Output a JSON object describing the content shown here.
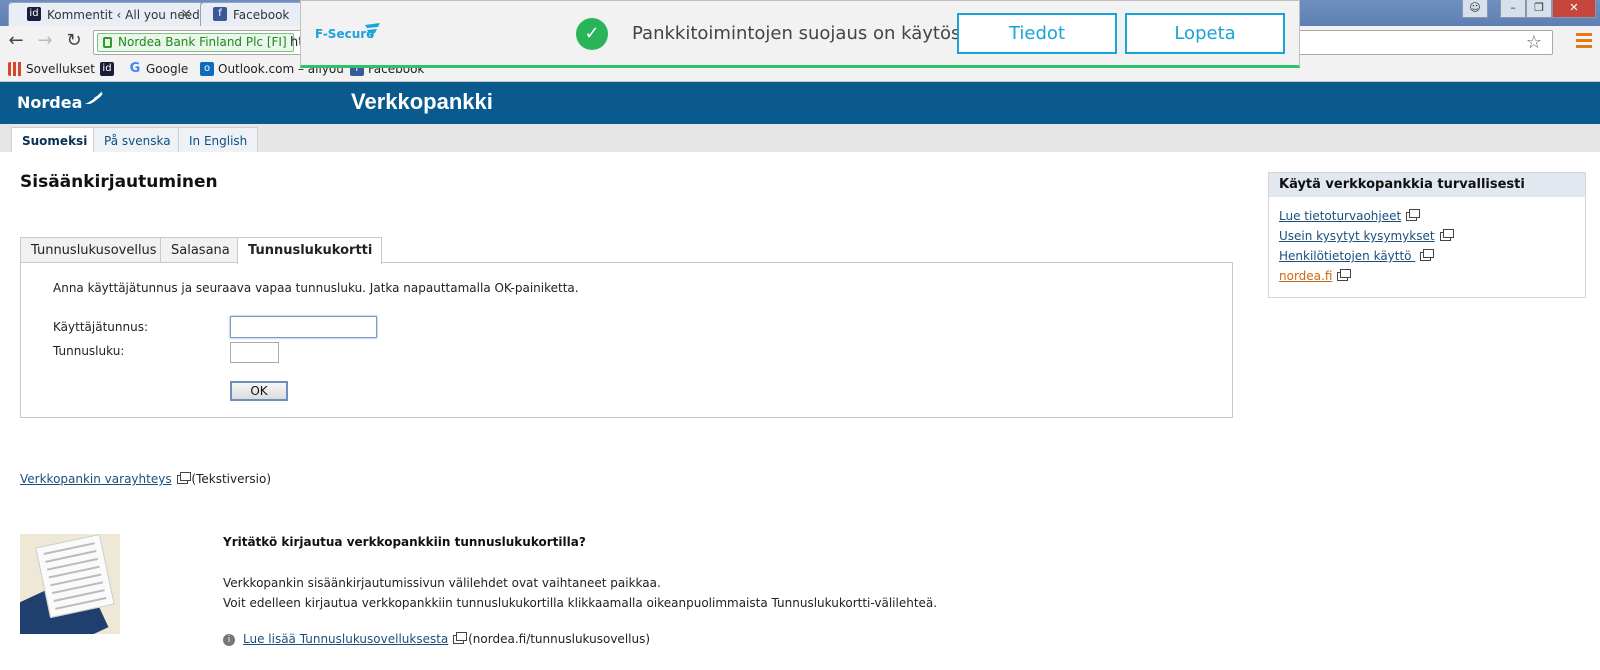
{
  "browser": {
    "tabs": [
      {
        "title": "Kommentit ‹ All you need",
        "icon": "id-icon"
      },
      {
        "title": "Facebook",
        "icon": "facebook-icon"
      }
    ],
    "ev_label": "Nordea Bank Finland Plc [FI]",
    "url_tail": "ht",
    "bookmarks": [
      {
        "label": "Sovellukset",
        "icon": "apps-grid-icon"
      },
      {
        "label": "",
        "icon": "id-icon"
      },
      {
        "label": "Google",
        "icon": "google-icon"
      },
      {
        "label": "Outlook.com – allyou",
        "icon": "outlook-icon"
      },
      {
        "label": "Facebook",
        "icon": "facebook-icon"
      }
    ]
  },
  "fsecure": {
    "logo": "F-Secure",
    "message": "Pankkitoimintojen suojaus on käytössä",
    "details_button": "Tiedot",
    "stop_button": "Lopeta",
    "accent": "#1aa3d9",
    "status_color": "#2ab45a"
  },
  "header": {
    "logo": "Nordea",
    "title": "Verkkopankki",
    "color": "#0a5a8e"
  },
  "languages": [
    "Suomeksi",
    "På svenska",
    "In English"
  ],
  "login": {
    "title": "Sisäänkirjautuminen",
    "tabs": [
      "Tunnuslukusovellus",
      "Salasana",
      "Tunnuslukukortti"
    ],
    "instruction": "Anna käyttäjätunnus ja seuraava vapaa tunnusluku. Jatka napauttamalla OK-painiketta.",
    "username_label": "Käyttäjätunnus:",
    "pin_label": "Tunnusluku:",
    "ok_button": "OK"
  },
  "sidebar": {
    "title": "Käytä verkkopankkia turvallisesti",
    "links": [
      "Lue tietoturvaohjeet",
      "Usein kysytyt kysymykset",
      "Henkilötietojen käyttö ",
      "nordea.fi"
    ]
  },
  "backup": {
    "link": "Verkkopankin varayhteys",
    "suffix": "(Tekstiversio)"
  },
  "notice": {
    "title": "Yritätkö kirjautua verkkopankkiin tunnuslukukortilla?",
    "line1": "Verkkopankin sisäänkirjautumissivun välilehdet ovat vaihtaneet paikkaa.",
    "line2": "Voit edelleen kirjautua verkkopankkiin tunnuslukukortilla klikkaamalla oikeanpuolimmaista Tunnuslukukortti-välilehteä.",
    "info_link": "Lue lisää Tunnuslukusovelluksesta",
    "info_suffix": "(nordea.fi/tunnuslukusovellus)"
  }
}
